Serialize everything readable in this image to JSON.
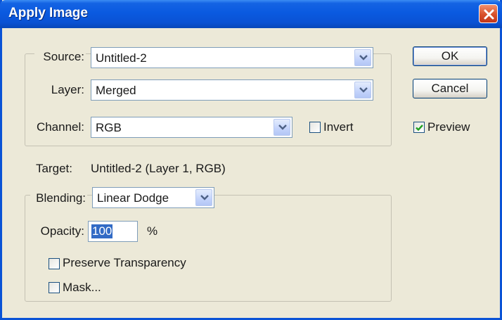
{
  "window": {
    "title": "Apply Image"
  },
  "source_group": {
    "source": {
      "label": "Source:",
      "value": "Untitled-2"
    },
    "layer": {
      "label": "Layer:",
      "value": "Merged"
    },
    "channel": {
      "label": "Channel:",
      "value": "RGB"
    },
    "invert": {
      "label": "Invert",
      "checked": false
    }
  },
  "buttons": {
    "ok": "OK",
    "cancel": "Cancel"
  },
  "preview": {
    "label": "Preview",
    "checked": true
  },
  "target": {
    "label": "Target:",
    "value": "Untitled-2 (Layer 1, RGB)"
  },
  "blending_group": {
    "blending": {
      "label": "Blending:",
      "value": "Linear Dodge"
    },
    "opacity": {
      "label": "Opacity:",
      "value": "100",
      "unit": "%"
    },
    "preserve_transparency": {
      "label": "Preserve Transparency",
      "checked": false
    },
    "mask": {
      "label": "Mask...",
      "checked": false
    }
  },
  "icons": {
    "close": "close-icon",
    "dropdown": "chevron-down-icon",
    "checkmark": "checkmark-icon"
  },
  "colors": {
    "titlebar": "#0a5ae0",
    "close_button": "#d8502a",
    "dialog_background": "#ece9d8",
    "selection": "#316ac5",
    "checkmark": "#21a121"
  }
}
